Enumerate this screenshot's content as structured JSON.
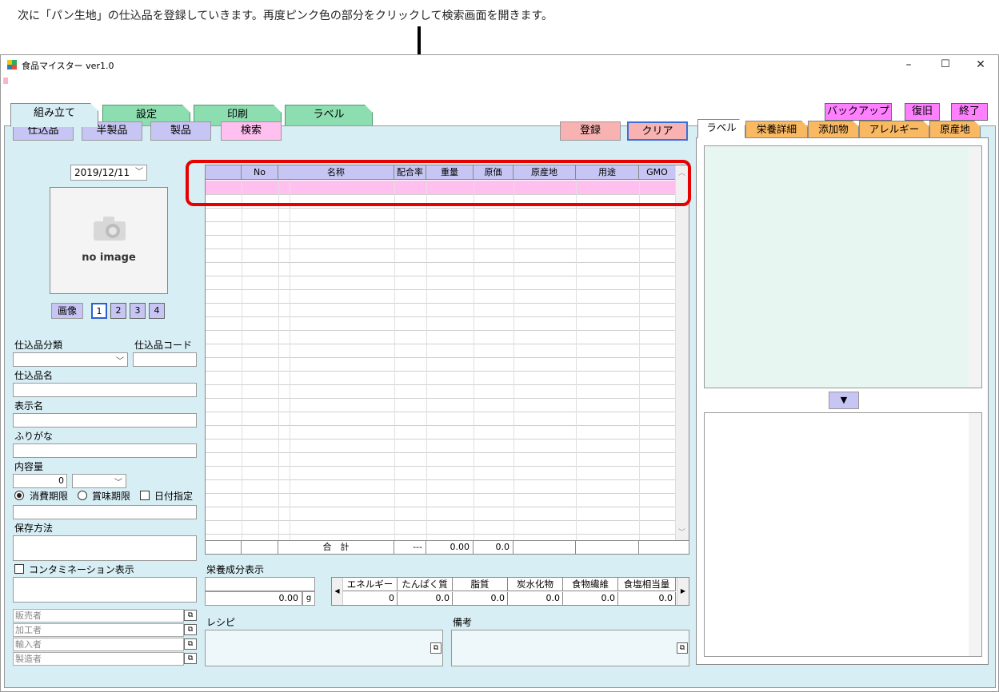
{
  "instruction": "次に「パン生地」の仕込品を登録していきます。再度ピンク色の部分をクリックして検索画面を開きます。",
  "window": {
    "title": "食品マイスター ver1.0",
    "minimize": "–",
    "maximize": "☐",
    "close": "✕"
  },
  "tabs": [
    "組み立て",
    "設定",
    "印刷",
    "ラベル"
  ],
  "top_buttons": {
    "backup": "バックアップ",
    "restore": "復旧",
    "exit": "終了"
  },
  "mode_buttons": {
    "shikomi": "仕込品",
    "hanseihin": "半製品",
    "seihin": "製品",
    "search": "検索"
  },
  "action_buttons": {
    "register": "登録",
    "clear": "クリア"
  },
  "date": "2019/12/11",
  "image": {
    "placeholder": "no image",
    "button": "画像",
    "pages": [
      "1",
      "2",
      "3",
      "4"
    ]
  },
  "form": {
    "category_label": "仕込品分類",
    "code_label": "仕込品コード",
    "name_label": "仕込品名",
    "display_name_label": "表示名",
    "furigana_label": "ふりがな",
    "content_label": "内容量",
    "content_value": "0",
    "radio_consume": "消費期限",
    "radio_best": "賞味期限",
    "check_date": "日付指定",
    "storage_label": "保存方法",
    "contamination_label": "コンタミネーション表示",
    "seller": "販売者",
    "processor": "加工者",
    "importer": "輸入者",
    "maker": "製造者"
  },
  "grid": {
    "headers": [
      "",
      "No",
      "名称",
      "配合率",
      "重量",
      "原価",
      "原産地",
      "用途",
      "GMO"
    ],
    "footer": {
      "label": "合　計",
      "ratio": "---",
      "weight": "0.00",
      "cost": "0.0"
    }
  },
  "nutrition": {
    "section_label": "栄養成分表示",
    "amount": "0.00",
    "unit": "g",
    "headers": [
      "エネルギー",
      "たんぱく質",
      "脂質",
      "炭水化物",
      "食物繊維",
      "食塩相当量"
    ],
    "values": [
      "0",
      "0.0",
      "0.0",
      "0.0",
      "0.0",
      "0.0"
    ]
  },
  "recipe_label": "レシピ",
  "notes_label": "備考",
  "right_tabs": [
    "ラベル",
    "栄養詳細",
    "添加物",
    "アレルギー",
    "原産地"
  ]
}
